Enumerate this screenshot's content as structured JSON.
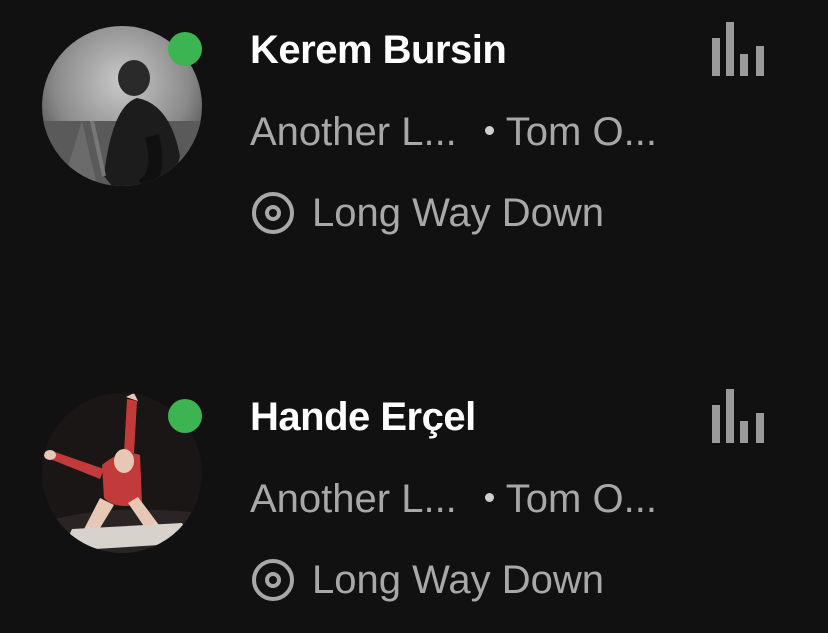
{
  "colors": {
    "background": "#121112",
    "online": "#3cb451",
    "name": "#ffffff",
    "secondary": "#a8a8a8"
  },
  "friends": [
    {
      "name": "Kerem Bursin",
      "track": "Another L...",
      "artist": "Tom O...",
      "context": "Long Way Down",
      "online": true,
      "avatar_icon": "avatar-photo",
      "activity_icon": "now-playing-bars-icon",
      "context_icon": "album-disc-icon"
    },
    {
      "name": "Hande Erçel",
      "track": "Another L...",
      "artist": "Tom O...",
      "context": "Long Way Down",
      "online": true,
      "avatar_icon": "avatar-photo",
      "activity_icon": "now-playing-bars-icon",
      "context_icon": "album-disc-icon"
    }
  ]
}
